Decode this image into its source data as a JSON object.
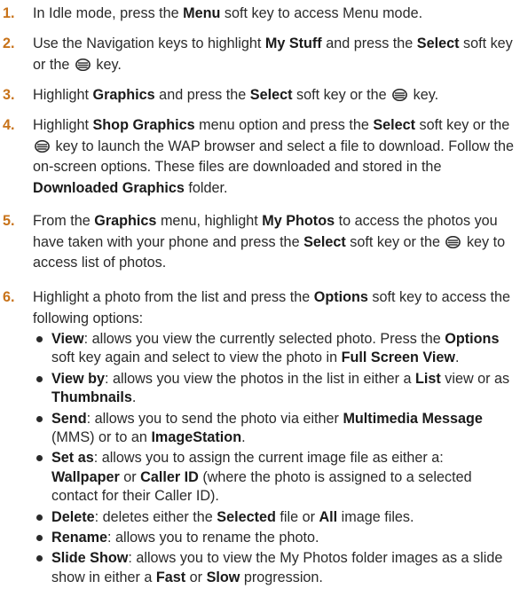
{
  "steps": [
    {
      "num": "1.",
      "parts": [
        "In Idle mode, press the ",
        "Menu",
        " soft key to access Menu mode."
      ]
    },
    {
      "num": "2.",
      "parts": [
        "Use the Navigation keys to highlight ",
        "My Stuff",
        " and press the ",
        "Select",
        " soft key or the ",
        "{icon}",
        " key."
      ]
    },
    {
      "num": "3.",
      "parts": [
        "Highlight ",
        "Graphics",
        " and press the ",
        "Select",
        " soft key or the ",
        "{icon}",
        " key."
      ]
    },
    {
      "num": "4.",
      "parts": [
        "Highlight ",
        "Shop Graphics",
        " menu option and press the ",
        "Select",
        " soft key or the ",
        "{icon}",
        " key to launch the WAP browser and select a file to download. Follow the on-screen options. These files are downloaded and stored in the ",
        "Downloaded Graphics",
        " folder."
      ]
    },
    {
      "num": "5.",
      "parts": [
        "From the ",
        "Graphics",
        " menu, highlight ",
        "My Photos",
        " to access the photos you have taken with your phone and press the ",
        "Select",
        " soft key or the ",
        "{icon}",
        " key to access list of photos."
      ]
    },
    {
      "num": "6.",
      "parts": [
        "Highlight a photo from the list and press the ",
        "Options",
        " soft key to access the following options:"
      ]
    }
  ],
  "bullets": [
    {
      "parts": [
        "View",
        ": allows you view the currently selected photo. Press the ",
        "Options",
        " soft key again and select to view the photo in ",
        "Full Screen View",
        "."
      ]
    },
    {
      "parts": [
        "View by",
        ": allows you view the photos in the list in either a ",
        "List",
        " view or as ",
        "Thumbnails",
        "."
      ]
    },
    {
      "parts": [
        "Send",
        ": allows you to send the photo via either ",
        "Multimedia Message",
        " (MMS) or to an ",
        "ImageStation",
        "."
      ]
    },
    {
      "parts": [
        "Set as",
        ": allows you to assign the current image file as either a: ",
        "Wallpaper",
        " or ",
        "Caller ID",
        " (where the photo is assigned to a selected contact for their Caller ID)."
      ]
    },
    {
      "parts": [
        "Delete",
        ": deletes either the ",
        "Selected",
        " file or ",
        "All",
        " image files."
      ]
    },
    {
      "parts": [
        "Rename",
        ": allows you to rename the photo."
      ]
    },
    {
      "parts": [
        "Slide Show",
        ": allows you to view the My Photos folder images as a slide show in either a ",
        "Fast",
        " or ",
        "Slow",
        " progression."
      ]
    }
  ],
  "icons": {
    "select_key": "select-key-icon"
  },
  "colors": {
    "step_number": "#c8731a",
    "text": "#2a2a2a"
  }
}
